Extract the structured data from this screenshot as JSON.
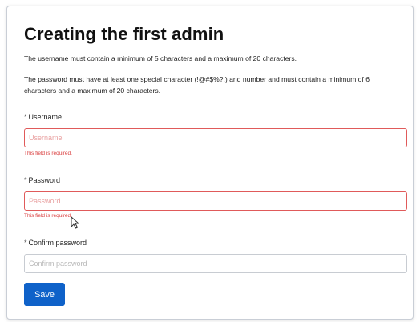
{
  "form": {
    "title": "Creating the first admin",
    "username_hint": "The username must contain a minimum of 5 characters and a maximum of 20 characters.",
    "password_hint": "The password must have at least one special character (!@#$%?.) and number and must contain a minimum of 6 characters and a maximum of 20 characters.",
    "required_marker": "*",
    "fields": {
      "username": {
        "label": "Username",
        "placeholder": "Username",
        "value": "",
        "error": "This field is required."
      },
      "password": {
        "label": "Password",
        "placeholder": "Password",
        "value": "",
        "error": "This field is required."
      },
      "confirm_password": {
        "label": "Confirm password",
        "placeholder": "Confirm password",
        "value": ""
      }
    },
    "save_label": "Save"
  },
  "colors": {
    "primary_button": "#0f62c9",
    "error": "#d93c3c",
    "error_border": "#e05a5a"
  },
  "icons": {
    "cursor": "mouse-pointer-icon"
  }
}
